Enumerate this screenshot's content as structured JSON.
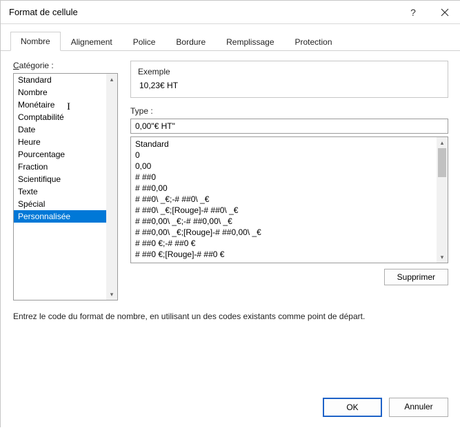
{
  "titlebar": {
    "title": "Format de cellule"
  },
  "tabs": [
    {
      "label": "Nombre",
      "active": true
    },
    {
      "label": "Alignement",
      "active": false
    },
    {
      "label": "Police",
      "active": false
    },
    {
      "label": "Bordure",
      "active": false
    },
    {
      "label": "Remplissage",
      "active": false
    },
    {
      "label": "Protection",
      "active": false
    }
  ],
  "category": {
    "label_prefix": "C",
    "label_rest": "atégorie :",
    "items": [
      "Standard",
      "Nombre",
      "Monétaire",
      "Comptabilité",
      "Date",
      "Heure",
      "Pourcentage",
      "Fraction",
      "Scientifique",
      "Texte",
      "Spécial",
      "Personnalisée"
    ],
    "selected_index": 11
  },
  "example": {
    "title": "Exemple",
    "value": "10,23€ HT"
  },
  "type": {
    "label": "Type :",
    "value": "0,00\"€ HT\""
  },
  "formats": [
    "Standard",
    "0",
    "0,00",
    "# ##0",
    "# ##0,00",
    "# ##0\\ _€;-# ##0\\ _€",
    "# ##0\\ _€;[Rouge]-# ##0\\ _€",
    "# ##0,00\\ _€;-# ##0,00\\ _€",
    "# ##0,00\\ _€;[Rouge]-# ##0,00\\ _€",
    "# ##0 €;-# ##0 €",
    "# ##0 €;[Rouge]-# ##0 €"
  ],
  "delete_btn": "Supprimer",
  "hint": "Entrez le code du format de nombre, en utilisant un des codes existants comme point de départ.",
  "buttons": {
    "ok": "OK",
    "cancel": "Annuler"
  }
}
